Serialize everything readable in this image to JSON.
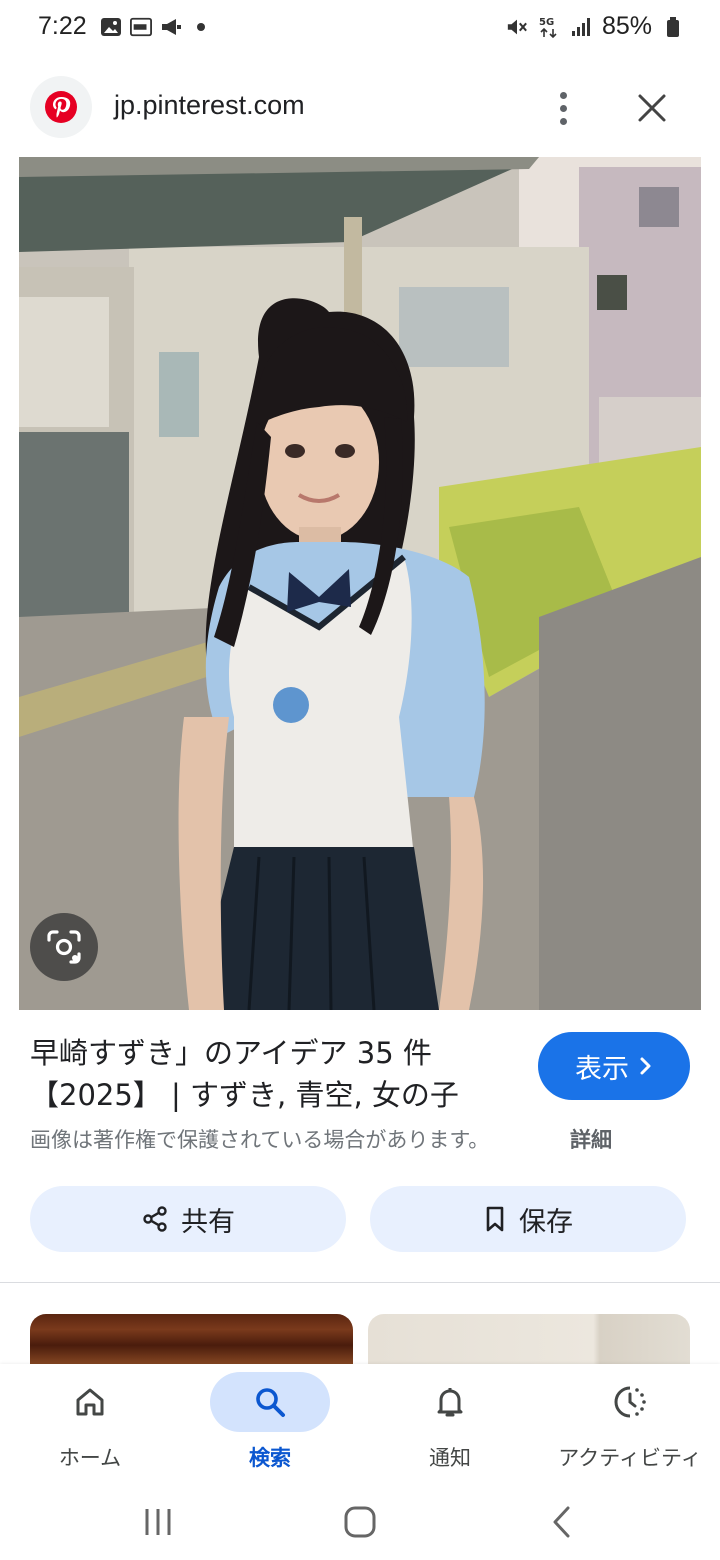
{
  "status_bar": {
    "time": "7:22",
    "battery": "85%",
    "network": "5G"
  },
  "url_bar": {
    "url": "jp.pinterest.com",
    "favicon": "pinterest-logo",
    "accent_color": "#e60023"
  },
  "image": {
    "lens_icon": "google-lens-icon"
  },
  "result": {
    "title_line1": "早崎すずき」のアイデア 35 件",
    "title_line2": "【2025】 | すずき, 青空, 女の子",
    "show_button": "表示",
    "copyright_notice": "画像は著作権で保護されている場合があります。",
    "details_link": "詳細"
  },
  "actions": {
    "share": "共有",
    "save": "保存"
  },
  "bottom_nav": {
    "items": [
      {
        "label": "ホーム",
        "icon": "home-icon"
      },
      {
        "label": "検索",
        "icon": "search-icon",
        "active": true
      },
      {
        "label": "通知",
        "icon": "bell-icon"
      },
      {
        "label": "アクティビティ",
        "icon": "activity-icon"
      }
    ]
  },
  "colors": {
    "primary": "#1a73e8",
    "active_nav": "#0b57d0",
    "button_bg": "#e8f0fe"
  }
}
